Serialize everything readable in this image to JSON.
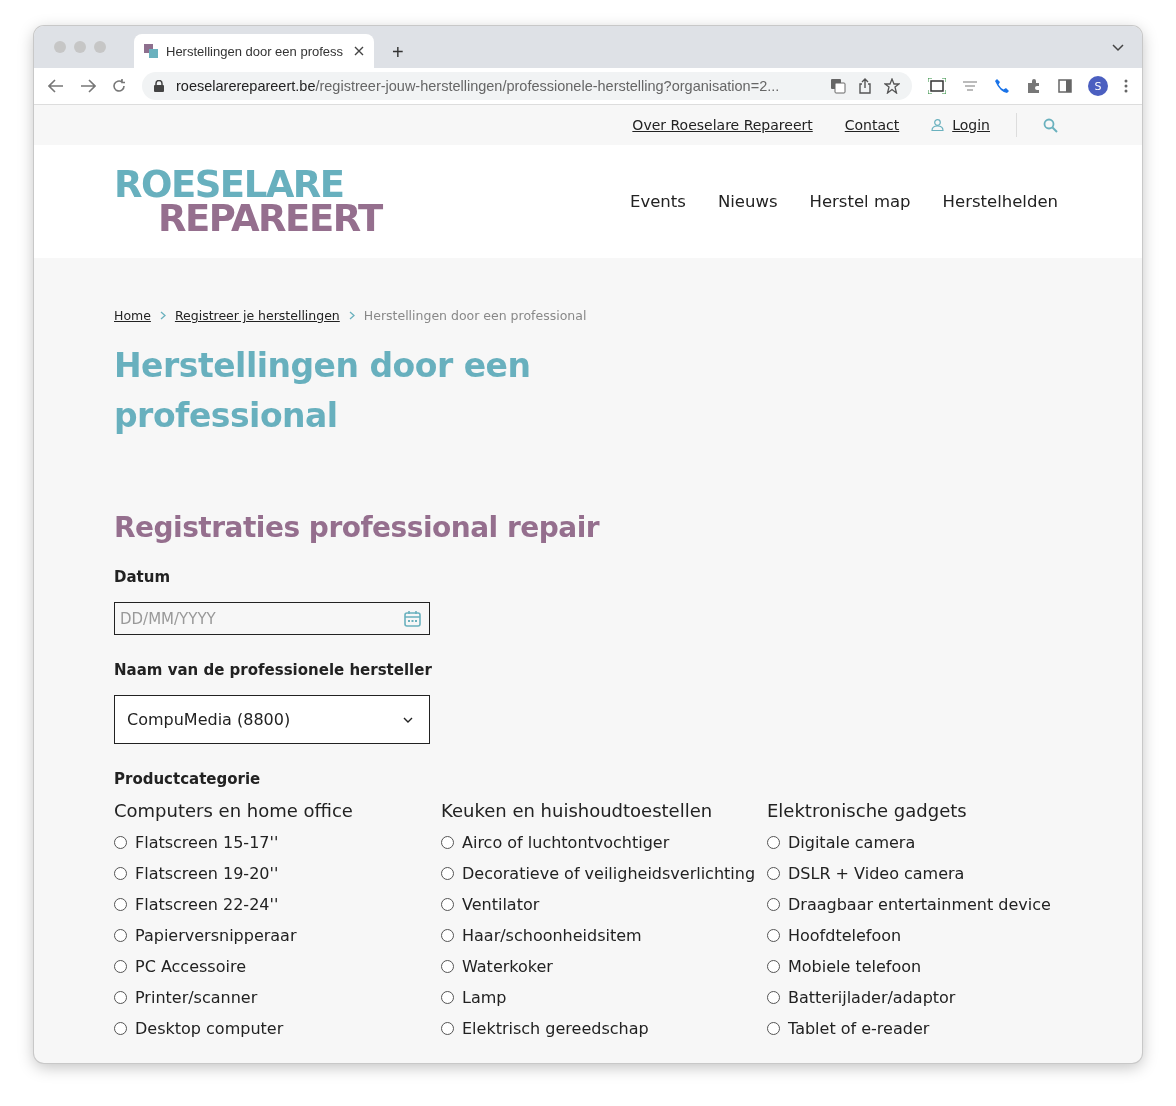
{
  "browser": {
    "tab_title": "Herstellingen door een profess",
    "new_tab": "+",
    "url_domain": "roeselarerepareert.be",
    "url_path": "/registreer-jouw-herstellingen/professionele-herstelling?organisation=2...",
    "profile_initial": "S"
  },
  "top_links": [
    {
      "label": "Over Roeselare Repareert",
      "kind": "link"
    },
    {
      "label": "Contact",
      "kind": "link"
    },
    {
      "label": "Login",
      "kind": "login"
    }
  ],
  "logo": {
    "line_1": "ROESELARE",
    "line_2": "REPAREERT"
  },
  "nav": [
    "Events",
    "Nieuws",
    "Herstel map",
    "Herstelhelden"
  ],
  "breadcrumb": [
    {
      "label": "Home",
      "current": false
    },
    {
      "label": "Registreer je herstellingen",
      "current": false
    },
    {
      "label": "Herstellingen door een professional",
      "current": true
    }
  ],
  "title": "Herstellingen door een professional",
  "form": {
    "heading": "Registraties professional repair",
    "date_label": "Datum",
    "date_placeholder": "DD/MM/YYYY",
    "repairer_label": "Naam van de professionele hersteller",
    "repairer_value": "CompuMedia (8800)",
    "category_label": "Productcategorie",
    "groups": [
      {
        "title": "Computers en home office",
        "options": [
          {
            "label": "Flatscreen 15-17''",
            "checked": false
          },
          {
            "label": "Flatscreen 19-20''",
            "checked": false
          },
          {
            "label": "Flatscreen 22-24''",
            "checked": false
          },
          {
            "label": "Papierversnipperaar",
            "checked": false
          },
          {
            "label": "PC Accessoire",
            "checked": false
          },
          {
            "label": "Printer/scanner",
            "checked": false
          },
          {
            "label": "Desktop computer",
            "checked": false
          }
        ]
      },
      {
        "title": "Keuken en huishoudtoestellen",
        "options": [
          {
            "label": "Airco of luchtontvochtiger",
            "checked": false
          },
          {
            "label": "Decoratieve of veiligheidsverlichting",
            "checked": false
          },
          {
            "label": "Ventilator",
            "checked": false
          },
          {
            "label": "Haar/schoonheidsitem",
            "checked": false
          },
          {
            "label": "Waterkoker",
            "checked": false
          },
          {
            "label": "Lamp",
            "checked": false
          },
          {
            "label": "Elektrisch gereedschap",
            "checked": false
          }
        ]
      },
      {
        "title": "Elektronische gadgets",
        "options": [
          {
            "label": "Digitale camera",
            "checked": false
          },
          {
            "label": "DSLR + Video camera",
            "checked": false
          },
          {
            "label": "Draagbaar entertainment device",
            "checked": false
          },
          {
            "label": "Hoofdtelefoon",
            "checked": false
          },
          {
            "label": "Mobiele telefoon",
            "checked": false
          },
          {
            "label": "Batterijlader/adaptor",
            "checked": false
          },
          {
            "label": "Tablet of e-reader",
            "checked": false
          }
        ]
      }
    ]
  }
}
